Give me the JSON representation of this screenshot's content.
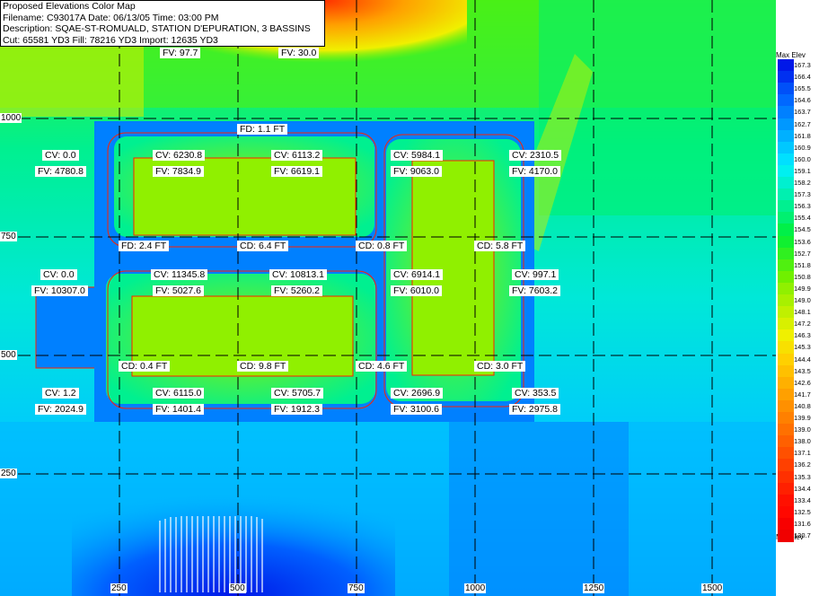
{
  "header": {
    "title": "Proposed Elevations Color Map",
    "filename": "Filename: C93017A  Date: 06/13/05  Time: 03:00 PM",
    "description": "Description: SQAE-ST-ROMUALD, STATION D'EPURATION, 3 BASSINS",
    "totals": "Cut: 65581 YD3 Fill: 78216 YD3  Import: 12635 YD3"
  },
  "axes": {
    "x_ticks": [
      "250",
      "500",
      "750",
      "1000",
      "1250",
      "1500"
    ],
    "y_ticks": [
      "1000",
      "750",
      "500",
      "250"
    ]
  },
  "labels": {
    "fv_top_a": "FV: 97.7",
    "fv_top_b": "FV: 30.0",
    "fd_top": "FD: 1.1 FT",
    "r1_cv_1": "CV: 0.0",
    "r1_fv_1": "FV: 4780.8",
    "r1_cv_2": "CV: 6230.8",
    "r1_fv_2": "FV: 7834.9",
    "r1_cv_3": "CV: 6113.2",
    "r1_fv_3": "FV: 6619.1",
    "r1_cv_4": "CV: 5984.1",
    "r1_fv_4": "FV: 9063.0",
    "r1_cv_5": "CV: 2310.5",
    "r1_fv_5": "FV: 4170.0",
    "r2_fd_1": "FD: 2.4 FT",
    "r2_cd_2": "CD: 6.4 FT",
    "r2_cd_3": "CD: 0.8 FT",
    "r2_cd_4": "CD: 5.8 FT",
    "r3_cv_1": "CV: 0.0",
    "r3_fv_1": "FV: 10307.0",
    "r3_cv_2": "CV: 11345.8",
    "r3_fv_2": "FV: 5027.6",
    "r3_cv_3": "CV: 10813.1",
    "r3_fv_3": "FV: 5260.2",
    "r3_cv_4": "CV: 6914.1",
    "r3_fv_4": "FV: 6010.0",
    "r3_cv_5": "CV: 997.1",
    "r3_fv_5": "FV: 7603.2",
    "r4_cd_1": "CD: 0.4 FT",
    "r4_cd_2": "CD: 9.8 FT",
    "r4_cd_3": "CD: 4.6 FT",
    "r4_cd_4": "CD: 3.0 FT",
    "r5_cv_1": "CV: 1.2",
    "r5_fv_1": "FV: 2024.9",
    "r5_cv_2": "CV: 6115.0",
    "r5_fv_2": "FV: 1401.4",
    "r5_cv_3": "CV: 5705.7",
    "r5_fv_3": "FV: 1912.3",
    "r5_cv_4": "CV: 2696.9",
    "r5_fv_4": "FV: 3100.6",
    "r5_cv_5": "CV: 353.5",
    "r5_fv_5": "FV: 2975.8"
  },
  "legend": {
    "max_label": "Max Elev",
    "min_label": "Min Elev",
    "values": [
      "167.3",
      "166.4",
      "165.5",
      "164.6",
      "163.7",
      "162.7",
      "161.8",
      "160.9",
      "160.0",
      "159.1",
      "158.2",
      "157.3",
      "156.3",
      "155.4",
      "154.5",
      "153.6",
      "152.7",
      "151.8",
      "150.8",
      "149.9",
      "149.0",
      "148.1",
      "147.2",
      "146.3",
      "145.3",
      "144.4",
      "143.5",
      "142.6",
      "141.7",
      "140.8",
      "139.9",
      "139.0",
      "138.0",
      "137.1",
      "136.2",
      "135.3",
      "134.4",
      "133.4",
      "132.5",
      "131.6",
      "130.7"
    ],
    "colors": [
      "#0018e8",
      "#0030f0",
      "#0050f8",
      "#0068ff",
      "#0080ff",
      "#0098ff",
      "#00b0ff",
      "#00c8ff",
      "#00e0ff",
      "#00f0f0",
      "#00f0d0",
      "#00f0b0",
      "#00f090",
      "#00f070",
      "#00f048",
      "#10f030",
      "#30f020",
      "#50f010",
      "#70f000",
      "#90f000",
      "#a8f000",
      "#c0f000",
      "#d8f000",
      "#f0f000",
      "#f8e000",
      "#ffd000",
      "#ffc000",
      "#ffb000",
      "#ffa000",
      "#ff9000",
      "#ff8000",
      "#ff7000",
      "#ff6000",
      "#ff5000",
      "#ff4000",
      "#ff3000",
      "#ff2000",
      "#ff1000",
      "#ff0800",
      "#f80000",
      "#f00000"
    ]
  }
}
